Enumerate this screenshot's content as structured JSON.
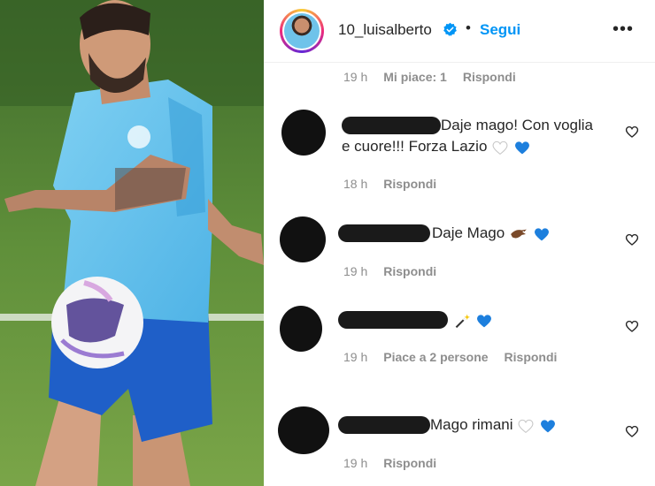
{
  "post": {
    "username": "10_luisalberto",
    "follow_label": "Segui",
    "dot": "•",
    "more": "•••"
  },
  "top_meta": {
    "time": "19 h",
    "likes": "Mi piace: 1",
    "reply": "Rispondi"
  },
  "comments": [
    {
      "text_line1": "Daje mago! Con voglia",
      "text_line2": "e cuore!!! Forza Lazio",
      "time": "18 h",
      "reply": "Rispondi",
      "emoji": [
        "white-heart",
        "blue-heart"
      ]
    },
    {
      "text": "Daje Mago",
      "time": "19 h",
      "reply": "Rispondi",
      "emoji": [
        "eagle",
        "blue-heart"
      ]
    },
    {
      "text": "",
      "time": "19 h",
      "likes": "Piace a 2 persone",
      "reply": "Rispondi",
      "emoji": [
        "magic-wand",
        "blue-heart"
      ]
    },
    {
      "text": "Mago rimani",
      "time": "19 h",
      "reply": "Rispondi",
      "emoji": [
        "white-heart",
        "blue-heart"
      ]
    }
  ],
  "colors": {
    "accent": "#0095f6",
    "blue_heart": "#1d7fdd",
    "lazio_blue": "#6fc3ea"
  }
}
